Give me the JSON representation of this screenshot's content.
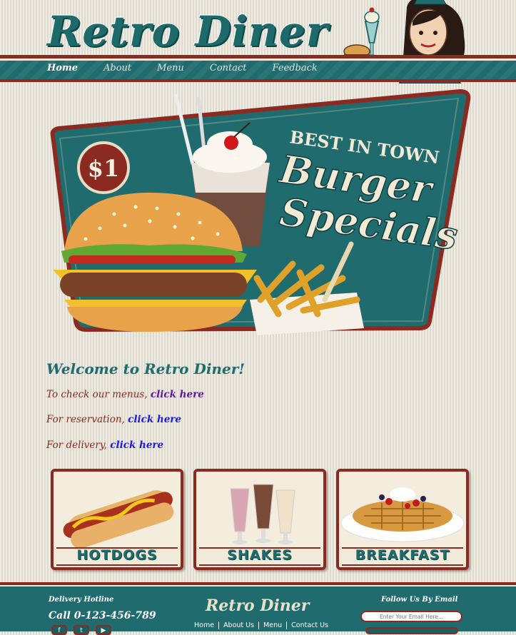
{
  "brand": {
    "logo_text": "Retro Diner",
    "colors": {
      "teal": "#1f6b6e",
      "red": "#8a2a20",
      "cream": "#e7e2d6"
    }
  },
  "nav": {
    "items": [
      {
        "label": "Home",
        "active": true
      },
      {
        "label": "About"
      },
      {
        "label": "Menu"
      },
      {
        "label": "Contact"
      },
      {
        "label": "Feedback"
      }
    ]
  },
  "hero": {
    "price": "$1",
    "tagline_small": "BEST IN TOWN",
    "tagline_line1": "Burger",
    "tagline_line2": "Specials"
  },
  "welcome": {
    "title": "Welcome to Retro Diner!",
    "lines": [
      {
        "text": "To check our menus,",
        "link": "click here"
      },
      {
        "text": "For reservation,",
        "link": "click here"
      },
      {
        "text": "For delivery,",
        "link": "click here"
      }
    ]
  },
  "tiles": [
    {
      "caption": "HOTDOGS",
      "icon": "hotdog-image"
    },
    {
      "caption": "SHAKES",
      "icon": "shakes-image"
    },
    {
      "caption": "BREAKFAST",
      "icon": "waffle-image"
    }
  ],
  "footer": {
    "hotline_label": "Delivery Hotline",
    "phone": "Call 0-123-456-789",
    "logo_text": "Retro Diner",
    "links": [
      "Home",
      "About Us",
      "Menu",
      "Contact Us"
    ],
    "follow_label": "Follow Us By Email",
    "email_placeholder": "Enter Your Email Here..."
  }
}
